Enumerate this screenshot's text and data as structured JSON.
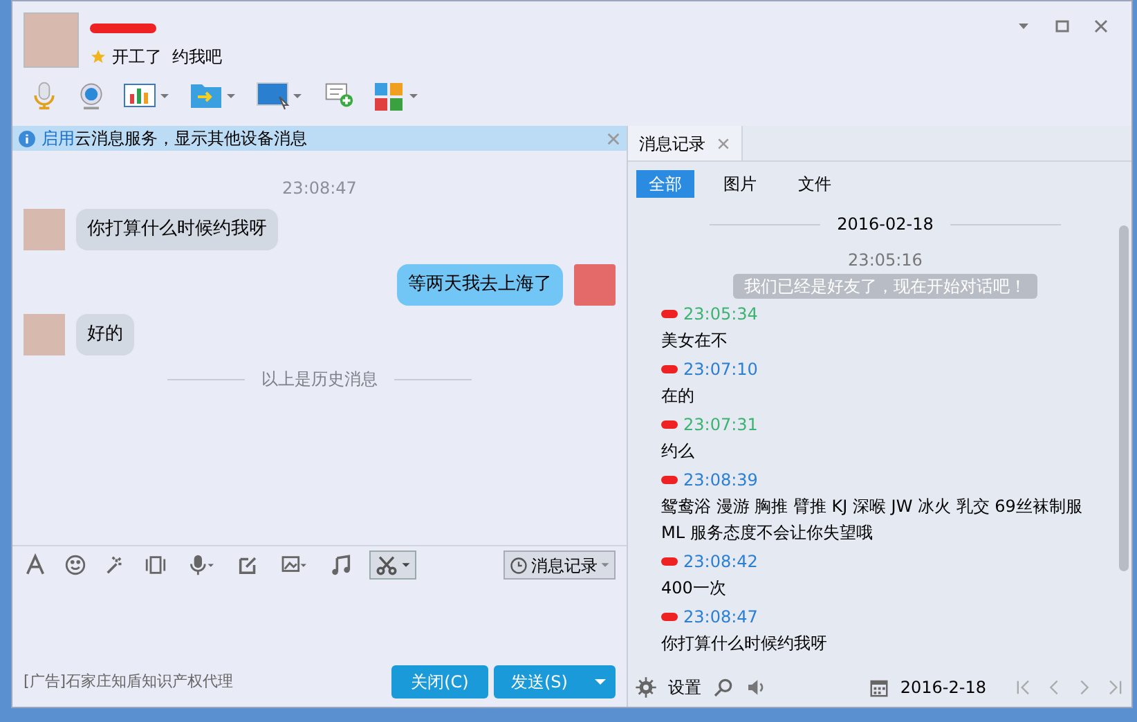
{
  "header": {
    "status": "开工了  约我吧"
  },
  "info_bar": {
    "link": "启用",
    "text": "云消息服务，显示其他设备消息"
  },
  "chat": {
    "time": "23:08:47",
    "messages": [
      {
        "kind": "incoming",
        "text": "你打算什么时候约我呀"
      },
      {
        "kind": "outgoing",
        "text": "等两天我去上海了"
      },
      {
        "kind": "incoming",
        "text": "好的"
      }
    ],
    "divider": "以上是历史消息"
  },
  "compose": {
    "history_button": "消息记录",
    "ad": "[广告]石家庄知盾知识产权代理",
    "close_button": "关闭(C)",
    "send_button": "发送(S)"
  },
  "history": {
    "tab": "消息记录",
    "filters": [
      {
        "label": "全部",
        "selected": true
      },
      {
        "label": "图片",
        "selected": false
      },
      {
        "label": "文件",
        "selected": false
      }
    ],
    "date": "2016-02-18",
    "time": "23:05:16",
    "system_message": "我们已经是好友了，现在开始对话吧！",
    "entries": [
      {
        "time": "23:05:34",
        "color": "#3cb371",
        "text": "美女在不"
      },
      {
        "time": "23:07:10",
        "color": "#2a7fd4",
        "text": "在的"
      },
      {
        "time": "23:07:31",
        "color": "#3cb371",
        "text": "约么"
      },
      {
        "time": "23:08:39",
        "color": "#2a7fd4",
        "text": "鸳鸯浴 漫游 胸推 臂推 KJ  深喉 JW 冰火 乳交 69丝袜制服 ML 服务态度不会让你失望哦"
      },
      {
        "time": "23:08:42",
        "color": "#2a7fd4",
        "text": "400一次"
      },
      {
        "time": "23:08:47",
        "color": "#2a7fd4",
        "text": "你打算什么时候约我呀"
      }
    ],
    "settings": "设置",
    "calendar_date": "2016-2-18"
  }
}
